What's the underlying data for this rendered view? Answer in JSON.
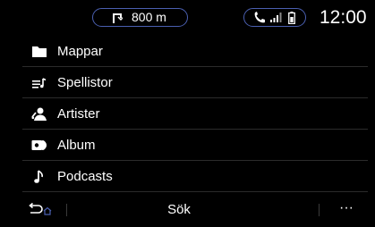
{
  "status_bar": {
    "nav_distance": "800 m",
    "nav_icon": "turn-right-icon",
    "phone_icons": [
      "phone-icon",
      "signal-icon",
      "battery-icon"
    ],
    "clock": "12:00",
    "accent_color": "#4a5fb0"
  },
  "library": {
    "items": [
      {
        "label": "Mappar",
        "icon": "folder-icon"
      },
      {
        "label": "Spellistor",
        "icon": "playlist-icon"
      },
      {
        "label": "Artister",
        "icon": "artist-icon"
      },
      {
        "label": "Album",
        "icon": "album-icon"
      },
      {
        "label": "Podcasts",
        "icon": "music-note-icon"
      }
    ]
  },
  "bottom_bar": {
    "back_icon": "back-home-icon",
    "search_label": "Sök",
    "more_label": "···"
  }
}
